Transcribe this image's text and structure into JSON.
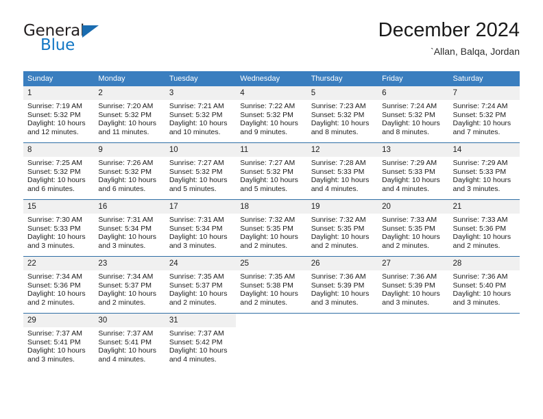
{
  "brand": {
    "line1": "General",
    "line2": "Blue",
    "triangle_color": "#1a6cb0",
    "blue_color": "#1277c4"
  },
  "header": {
    "title": "December 2024",
    "subtitle": "`Allan, Balqa, Jordan"
  },
  "theme": {
    "header_row_bg": "#3a7ebf",
    "daynum_bg": "#f0f0f0",
    "row_divider": "#2d6da4",
    "text": "#1a1a1a"
  },
  "weekdays": [
    "Sunday",
    "Monday",
    "Tuesday",
    "Wednesday",
    "Thursday",
    "Friday",
    "Saturday"
  ],
  "weeks": [
    [
      {
        "day": "1",
        "sunrise": "Sunrise: 7:19 AM",
        "sunset": "Sunset: 5:32 PM",
        "daylight1": "Daylight: 10 hours",
        "daylight2": "and 12 minutes."
      },
      {
        "day": "2",
        "sunrise": "Sunrise: 7:20 AM",
        "sunset": "Sunset: 5:32 PM",
        "daylight1": "Daylight: 10 hours",
        "daylight2": "and 11 minutes."
      },
      {
        "day": "3",
        "sunrise": "Sunrise: 7:21 AM",
        "sunset": "Sunset: 5:32 PM",
        "daylight1": "Daylight: 10 hours",
        "daylight2": "and 10 minutes."
      },
      {
        "day": "4",
        "sunrise": "Sunrise: 7:22 AM",
        "sunset": "Sunset: 5:32 PM",
        "daylight1": "Daylight: 10 hours",
        "daylight2": "and 9 minutes."
      },
      {
        "day": "5",
        "sunrise": "Sunrise: 7:23 AM",
        "sunset": "Sunset: 5:32 PM",
        "daylight1": "Daylight: 10 hours",
        "daylight2": "and 8 minutes."
      },
      {
        "day": "6",
        "sunrise": "Sunrise: 7:24 AM",
        "sunset": "Sunset: 5:32 PM",
        "daylight1": "Daylight: 10 hours",
        "daylight2": "and 8 minutes."
      },
      {
        "day": "7",
        "sunrise": "Sunrise: 7:24 AM",
        "sunset": "Sunset: 5:32 PM",
        "daylight1": "Daylight: 10 hours",
        "daylight2": "and 7 minutes."
      }
    ],
    [
      {
        "day": "8",
        "sunrise": "Sunrise: 7:25 AM",
        "sunset": "Sunset: 5:32 PM",
        "daylight1": "Daylight: 10 hours",
        "daylight2": "and 6 minutes."
      },
      {
        "day": "9",
        "sunrise": "Sunrise: 7:26 AM",
        "sunset": "Sunset: 5:32 PM",
        "daylight1": "Daylight: 10 hours",
        "daylight2": "and 6 minutes."
      },
      {
        "day": "10",
        "sunrise": "Sunrise: 7:27 AM",
        "sunset": "Sunset: 5:32 PM",
        "daylight1": "Daylight: 10 hours",
        "daylight2": "and 5 minutes."
      },
      {
        "day": "11",
        "sunrise": "Sunrise: 7:27 AM",
        "sunset": "Sunset: 5:32 PM",
        "daylight1": "Daylight: 10 hours",
        "daylight2": "and 5 minutes."
      },
      {
        "day": "12",
        "sunrise": "Sunrise: 7:28 AM",
        "sunset": "Sunset: 5:33 PM",
        "daylight1": "Daylight: 10 hours",
        "daylight2": "and 4 minutes."
      },
      {
        "day": "13",
        "sunrise": "Sunrise: 7:29 AM",
        "sunset": "Sunset: 5:33 PM",
        "daylight1": "Daylight: 10 hours",
        "daylight2": "and 4 minutes."
      },
      {
        "day": "14",
        "sunrise": "Sunrise: 7:29 AM",
        "sunset": "Sunset: 5:33 PM",
        "daylight1": "Daylight: 10 hours",
        "daylight2": "and 3 minutes."
      }
    ],
    [
      {
        "day": "15",
        "sunrise": "Sunrise: 7:30 AM",
        "sunset": "Sunset: 5:33 PM",
        "daylight1": "Daylight: 10 hours",
        "daylight2": "and 3 minutes."
      },
      {
        "day": "16",
        "sunrise": "Sunrise: 7:31 AM",
        "sunset": "Sunset: 5:34 PM",
        "daylight1": "Daylight: 10 hours",
        "daylight2": "and 3 minutes."
      },
      {
        "day": "17",
        "sunrise": "Sunrise: 7:31 AM",
        "sunset": "Sunset: 5:34 PM",
        "daylight1": "Daylight: 10 hours",
        "daylight2": "and 3 minutes."
      },
      {
        "day": "18",
        "sunrise": "Sunrise: 7:32 AM",
        "sunset": "Sunset: 5:35 PM",
        "daylight1": "Daylight: 10 hours",
        "daylight2": "and 2 minutes."
      },
      {
        "day": "19",
        "sunrise": "Sunrise: 7:32 AM",
        "sunset": "Sunset: 5:35 PM",
        "daylight1": "Daylight: 10 hours",
        "daylight2": "and 2 minutes."
      },
      {
        "day": "20",
        "sunrise": "Sunrise: 7:33 AM",
        "sunset": "Sunset: 5:35 PM",
        "daylight1": "Daylight: 10 hours",
        "daylight2": "and 2 minutes."
      },
      {
        "day": "21",
        "sunrise": "Sunrise: 7:33 AM",
        "sunset": "Sunset: 5:36 PM",
        "daylight1": "Daylight: 10 hours",
        "daylight2": "and 2 minutes."
      }
    ],
    [
      {
        "day": "22",
        "sunrise": "Sunrise: 7:34 AM",
        "sunset": "Sunset: 5:36 PM",
        "daylight1": "Daylight: 10 hours",
        "daylight2": "and 2 minutes."
      },
      {
        "day": "23",
        "sunrise": "Sunrise: 7:34 AM",
        "sunset": "Sunset: 5:37 PM",
        "daylight1": "Daylight: 10 hours",
        "daylight2": "and 2 minutes."
      },
      {
        "day": "24",
        "sunrise": "Sunrise: 7:35 AM",
        "sunset": "Sunset: 5:37 PM",
        "daylight1": "Daylight: 10 hours",
        "daylight2": "and 2 minutes."
      },
      {
        "day": "25",
        "sunrise": "Sunrise: 7:35 AM",
        "sunset": "Sunset: 5:38 PM",
        "daylight1": "Daylight: 10 hours",
        "daylight2": "and 2 minutes."
      },
      {
        "day": "26",
        "sunrise": "Sunrise: 7:36 AM",
        "sunset": "Sunset: 5:39 PM",
        "daylight1": "Daylight: 10 hours",
        "daylight2": "and 3 minutes."
      },
      {
        "day": "27",
        "sunrise": "Sunrise: 7:36 AM",
        "sunset": "Sunset: 5:39 PM",
        "daylight1": "Daylight: 10 hours",
        "daylight2": "and 3 minutes."
      },
      {
        "day": "28",
        "sunrise": "Sunrise: 7:36 AM",
        "sunset": "Sunset: 5:40 PM",
        "daylight1": "Daylight: 10 hours",
        "daylight2": "and 3 minutes."
      }
    ],
    [
      {
        "day": "29",
        "sunrise": "Sunrise: 7:37 AM",
        "sunset": "Sunset: 5:41 PM",
        "daylight1": "Daylight: 10 hours",
        "daylight2": "and 3 minutes."
      },
      {
        "day": "30",
        "sunrise": "Sunrise: 7:37 AM",
        "sunset": "Sunset: 5:41 PM",
        "daylight1": "Daylight: 10 hours",
        "daylight2": "and 4 minutes."
      },
      {
        "day": "31",
        "sunrise": "Sunrise: 7:37 AM",
        "sunset": "Sunset: 5:42 PM",
        "daylight1": "Daylight: 10 hours",
        "daylight2": "and 4 minutes."
      },
      {
        "day": "",
        "sunrise": "",
        "sunset": "",
        "daylight1": "",
        "daylight2": ""
      },
      {
        "day": "",
        "sunrise": "",
        "sunset": "",
        "daylight1": "",
        "daylight2": ""
      },
      {
        "day": "",
        "sunrise": "",
        "sunset": "",
        "daylight1": "",
        "daylight2": ""
      },
      {
        "day": "",
        "sunrise": "",
        "sunset": "",
        "daylight1": "",
        "daylight2": ""
      }
    ]
  ]
}
